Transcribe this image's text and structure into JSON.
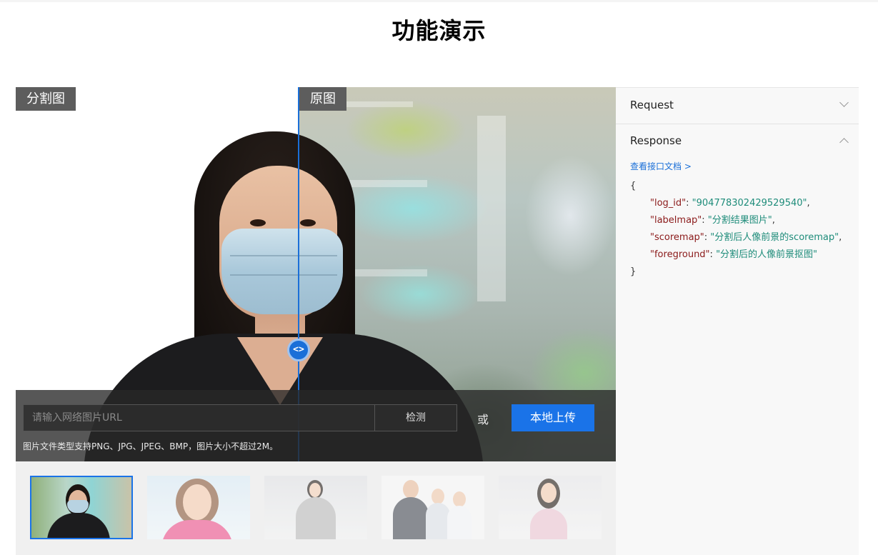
{
  "page": {
    "title": "功能演示"
  },
  "stage": {
    "segmented_label": "分割图",
    "original_label": "原图",
    "handle_glyph": "<>"
  },
  "input": {
    "url_placeholder": "请输入网络图片URL",
    "url_value": "",
    "detect_label": "检测",
    "or_text": "或",
    "upload_label": "本地上传",
    "hint": "图片文件类型支持PNG、JPG、JPEG、BMP，图片大小不超过2M。"
  },
  "thumbnails": [
    {
      "name": "woman-mask",
      "active": true
    },
    {
      "name": "smiling-woman",
      "active": false
    },
    {
      "name": "woman-gray-sweater",
      "active": false
    },
    {
      "name": "business-group",
      "active": false
    },
    {
      "name": "woman-pink-top",
      "active": false
    }
  ],
  "panel": {
    "request_label": "Request",
    "response_label": "Response",
    "doc_link": "查看接口文档 >",
    "json_open": "{",
    "json_close": "}",
    "fields": [
      {
        "key": "\"log_id\"",
        "sep": ": ",
        "value": "\"904778302429529540\"",
        "tail": ","
      },
      {
        "key": "\"labelmap\"",
        "sep": ": ",
        "value": "\"分割结果图片\"",
        "tail": ","
      },
      {
        "key": "\"scoremap\"",
        "sep": ": ",
        "value": "\"分割后人像前景的scoremap\"",
        "tail": ","
      },
      {
        "key": "\"foreground\"",
        "sep": ": ",
        "value": "\"分割后的人像前景抠图\"",
        "tail": ""
      }
    ]
  },
  "colors": {
    "accent": "#1a73e8",
    "json_key": "#8b1a1a",
    "json_value": "#1e8c7a"
  },
  "icons": {
    "request_toggle": "chevron-down-icon",
    "response_toggle": "chevron-up-icon",
    "compare_handle": "compare-arrows-icon"
  }
}
